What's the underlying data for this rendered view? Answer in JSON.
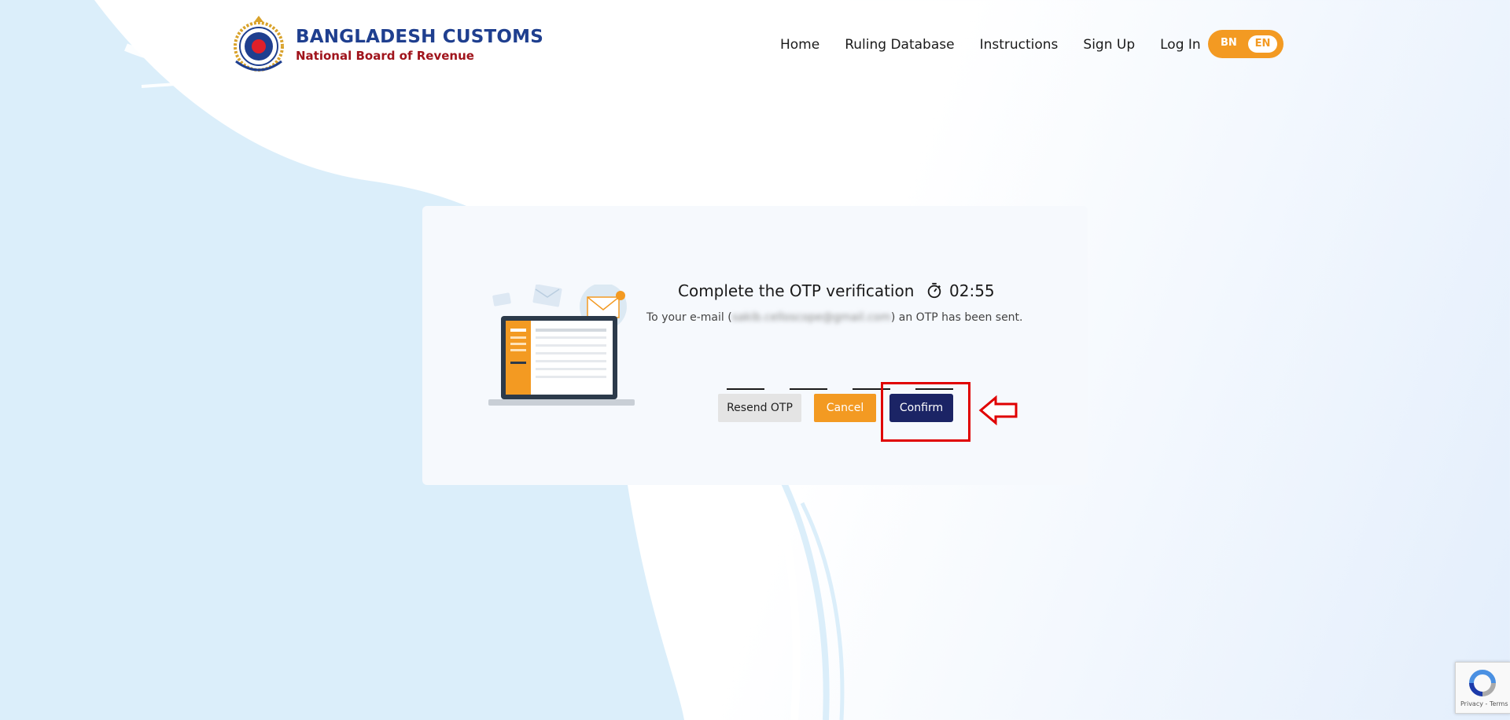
{
  "header": {
    "logo_emblem_text": "BANGLADESH CUSTOMS & VAT",
    "logo_title": "BANGLADESH CUSTOMS",
    "logo_subtitle": "National Board of Revenue",
    "nav": [
      {
        "label": "Home"
      },
      {
        "label": "Ruling Database"
      },
      {
        "label": "Instructions"
      },
      {
        "label": "Sign Up"
      },
      {
        "label": "Log In"
      }
    ],
    "language": {
      "bn": "BN",
      "en": "EN",
      "selected": "EN"
    }
  },
  "otp": {
    "title": "Complete the OTP verification",
    "timer": "02:55",
    "message_prefix": "To your e-mail (",
    "email": "sakib.celloscope@gmail.com",
    "message_suffix": ") an OTP has been sent.",
    "digits": [
      "",
      "",
      "",
      ""
    ],
    "buttons": {
      "resend": "Resend OTP",
      "cancel": "Cancel",
      "confirm": "Confirm"
    }
  },
  "recaptcha": {
    "terms": "Privacy - Terms"
  },
  "colors": {
    "brand_blue": "#1f3f8f",
    "brand_red": "#a0141c",
    "accent_orange": "#f39a22",
    "confirm_navy": "#1b2465",
    "highlight_red": "#e00000"
  },
  "icons": {
    "timer": "stopwatch-icon",
    "annotation_arrow": "arrow-left-icon"
  }
}
